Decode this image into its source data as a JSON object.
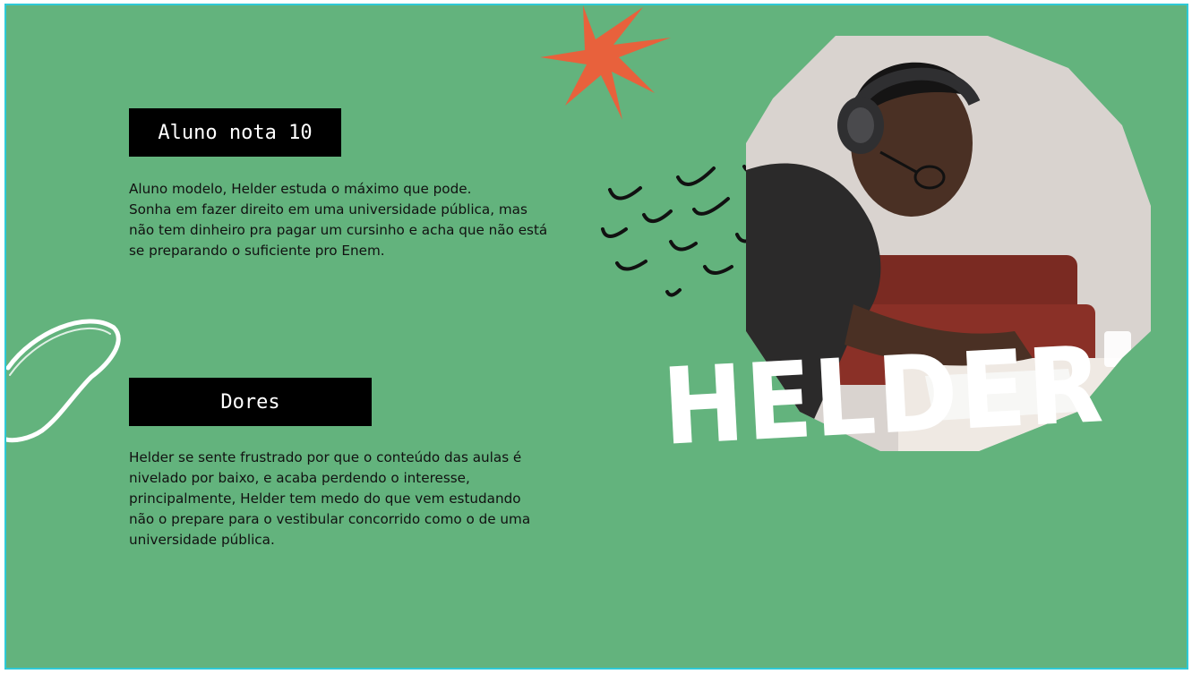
{
  "colors": {
    "background": "#63b37d",
    "accent_star": "#e8613c",
    "label_bg": "#000000",
    "name_color": "#ffffff"
  },
  "section1": {
    "label": "Aluno nota 10",
    "text": "Aluno modelo, Helder estuda o máximo que pode.\nSonha em fazer direito em uma universidade pública, mas não tem dinheiro pra pagar um cursinho e acha que não está se preparando o suficiente pro Enem."
  },
  "section2": {
    "label": "Dores",
    "text": "Helder se sente frustrado por que o conteúdo das aulas é nivelado por baixo, e acaba perdendo o interesse, principalmente, Helder tem medo do que vem estudando não o prepare para o vestibular concorrido como o de uma universidade pública."
  },
  "persona": {
    "name": "HELDER",
    "photo_icon": "student-with-headphones-photo"
  },
  "icons": {
    "star": "star-burst-icon",
    "loop": "brush-loop-icon",
    "marks": "check-marks-icon"
  }
}
